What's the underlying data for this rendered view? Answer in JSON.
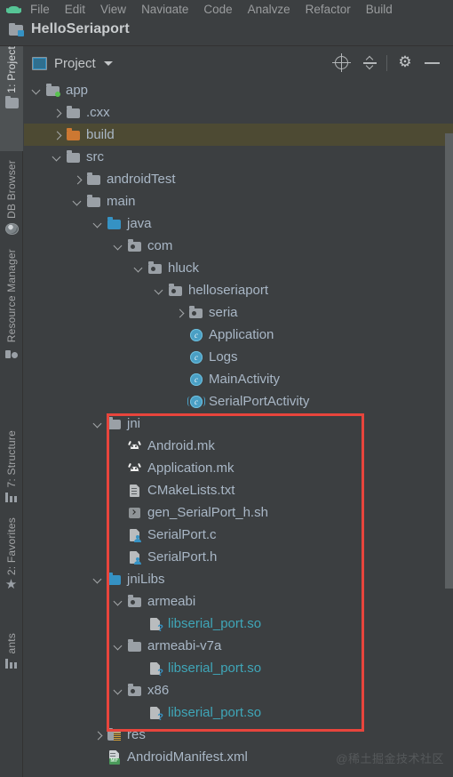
{
  "menubar": {
    "logo_icon": "android-logo-icon",
    "items": [
      {
        "label": "File",
        "mnemonic": "F"
      },
      {
        "label": "Edit",
        "mnemonic": "E"
      },
      {
        "label": "View",
        "mnemonic": "V"
      },
      {
        "label": "Navigate",
        "mnemonic": "N"
      },
      {
        "label": "Code",
        "mnemonic": "C"
      },
      {
        "label": "Analyze",
        "mnemonic": "z"
      },
      {
        "label": "Refactor",
        "mnemonic": "R"
      },
      {
        "label": "Build",
        "mnemonic": "B"
      }
    ]
  },
  "titlebar": {
    "project_name": "HelloSeriaport",
    "icon": "project-folder-icon"
  },
  "toolwindow": {
    "combo_label": "Project",
    "combo_icon": "project-view-icon",
    "caret_icon": "chevron-down-icon",
    "buttons": [
      {
        "name": "locate-icon",
        "tooltip": "Select Opened File"
      },
      {
        "name": "collapse-all-icon",
        "tooltip": "Collapse All"
      },
      {
        "name": "gear-icon",
        "tooltip": "Settings"
      },
      {
        "name": "minimize-icon",
        "tooltip": "Hide"
      }
    ]
  },
  "left_strip": [
    {
      "label": "1: Project",
      "mnemonic": "1",
      "icon": "project-icon",
      "active": true
    },
    {
      "label": "DB Browser",
      "icon": "database-icon",
      "active": false
    },
    {
      "label": "Resource Manager",
      "icon": "resource-manager-icon",
      "active": false
    },
    {
      "label": "7: Structure",
      "mnemonic": "7",
      "icon": "structure-icon",
      "active": false
    },
    {
      "label": "2: Favorites",
      "mnemonic": "2",
      "icon": "star-icon",
      "active": false
    },
    {
      "label": "ants",
      "icon": "build-variants-icon",
      "active": false
    }
  ],
  "colors": {
    "background": "#3c3f41",
    "selection": "#4d4a33",
    "text": "#a9b7c6",
    "accent_teal": "#3fa6b8",
    "annotation_red": "#e8453c",
    "folder_blue": "#3592c4",
    "folder_orange": "#cc7832",
    "folder_grey": "#9aa0a6"
  },
  "tree": [
    {
      "label": "app",
      "depth": 1,
      "arrow": "down",
      "icon": "folder-module-icon",
      "style": "plain",
      "selected": false
    },
    {
      "label": ".cxx",
      "depth": 2,
      "arrow": "right",
      "icon": "folder-grey-icon",
      "style": "plain",
      "selected": false
    },
    {
      "label": "build",
      "depth": 2,
      "arrow": "right",
      "icon": "folder-orange-icon",
      "style": "plain",
      "selected": true
    },
    {
      "label": "src",
      "depth": 2,
      "arrow": "down",
      "icon": "folder-grey-icon",
      "style": "plain",
      "selected": false
    },
    {
      "label": "androidTest",
      "depth": 3,
      "arrow": "right",
      "icon": "folder-grey-icon",
      "style": "plain",
      "selected": false
    },
    {
      "label": "main",
      "depth": 3,
      "arrow": "down",
      "icon": "folder-grey-icon",
      "style": "plain",
      "selected": false
    },
    {
      "label": "java",
      "depth": 4,
      "arrow": "down",
      "icon": "folder-source-icon",
      "style": "plain",
      "selected": false
    },
    {
      "label": "com",
      "depth": 5,
      "arrow": "down",
      "icon": "package-icon",
      "style": "plain",
      "selected": false
    },
    {
      "label": "hluck",
      "depth": 6,
      "arrow": "down",
      "icon": "package-icon",
      "style": "plain",
      "selected": false
    },
    {
      "label": "helloseriaport",
      "depth": 7,
      "arrow": "down",
      "icon": "package-icon",
      "style": "plain",
      "selected": false
    },
    {
      "label": "seria",
      "depth": 8,
      "arrow": "right",
      "icon": "package-icon",
      "style": "plain",
      "selected": false
    },
    {
      "label": "Application",
      "depth": 8,
      "arrow": "none",
      "icon": "java-class-icon",
      "style": "plain",
      "selected": false
    },
    {
      "label": "Logs",
      "depth": 8,
      "arrow": "none",
      "icon": "java-class-icon",
      "style": "plain",
      "selected": false
    },
    {
      "label": "MainActivity",
      "depth": 8,
      "arrow": "none",
      "icon": "java-class-icon",
      "style": "plain",
      "selected": false
    },
    {
      "label": "SerialPortActivity",
      "depth": 8,
      "arrow": "none",
      "icon": "java-abstract-class-icon",
      "style": "plain",
      "selected": false
    },
    {
      "label": "jni",
      "depth": 4,
      "arrow": "down",
      "icon": "folder-grey-icon",
      "style": "plain",
      "selected": false
    },
    {
      "label": "Android.mk",
      "depth": 5,
      "arrow": "none",
      "icon": "makefile-icon",
      "style": "plain",
      "selected": false
    },
    {
      "label": "Application.mk",
      "depth": 5,
      "arrow": "none",
      "icon": "makefile-icon",
      "style": "plain",
      "selected": false
    },
    {
      "label": "CMakeLists.txt",
      "depth": 5,
      "arrow": "none",
      "icon": "text-file-icon",
      "style": "plain",
      "selected": false
    },
    {
      "label": "gen_SerialPort_h.sh",
      "depth": 5,
      "arrow": "none",
      "icon": "shell-script-icon",
      "style": "plain",
      "selected": false
    },
    {
      "label": "SerialPort.c",
      "depth": 5,
      "arrow": "none",
      "icon": "c-source-icon",
      "style": "plain",
      "selected": false
    },
    {
      "label": "SerialPort.h",
      "depth": 5,
      "arrow": "none",
      "icon": "c-source-icon",
      "style": "plain",
      "selected": false
    },
    {
      "label": "jniLibs",
      "depth": 4,
      "arrow": "down",
      "icon": "folder-source-icon",
      "style": "plain",
      "selected": false
    },
    {
      "label": "armeabi",
      "depth": 5,
      "arrow": "down",
      "icon": "package-icon",
      "style": "plain",
      "selected": false
    },
    {
      "label": "libserial_port.so",
      "depth": 6,
      "arrow": "none",
      "icon": "unknown-file-icon",
      "style": "teal",
      "selected": false
    },
    {
      "label": "armeabi-v7a",
      "depth": 5,
      "arrow": "down",
      "icon": "folder-grey-icon",
      "style": "plain",
      "selected": false
    },
    {
      "label": "libserial_port.so",
      "depth": 6,
      "arrow": "none",
      "icon": "unknown-file-icon",
      "style": "teal",
      "selected": false
    },
    {
      "label": "x86",
      "depth": 5,
      "arrow": "down",
      "icon": "package-icon",
      "style": "plain",
      "selected": false
    },
    {
      "label": "libserial_port.so",
      "depth": 6,
      "arrow": "none",
      "icon": "unknown-file-icon",
      "style": "teal",
      "selected": false
    },
    {
      "label": "res",
      "depth": 4,
      "arrow": "right",
      "icon": "res-folder-icon",
      "style": "plain",
      "selected": false
    },
    {
      "label": "AndroidManifest.xml",
      "depth": 4,
      "arrow": "none",
      "icon": "manifest-icon",
      "style": "plain",
      "selected": false
    }
  ],
  "annotation": {
    "shape": "rectangle",
    "color": "#e8453c",
    "covers": "jni and jniLibs folders"
  },
  "watermark": "@稀土掘金技术社区"
}
